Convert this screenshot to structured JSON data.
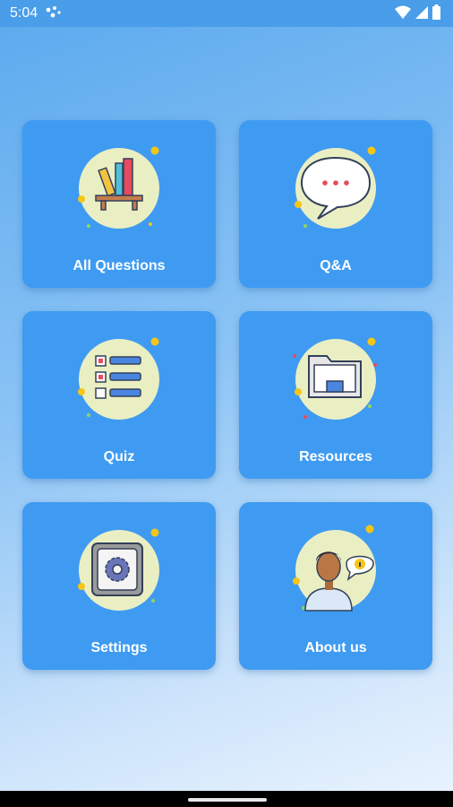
{
  "status_bar": {
    "time": "5:04",
    "icons": [
      "notification-dots-icon",
      "wifi-icon",
      "signal-icon",
      "battery-icon"
    ]
  },
  "menu": {
    "tiles": [
      {
        "label": "All Questions",
        "icon": "bookshelf-icon"
      },
      {
        "label": "Q&A",
        "icon": "speech-bubble-icon"
      },
      {
        "label": "Quiz",
        "icon": "checklist-icon"
      },
      {
        "label": "Resources",
        "icon": "folder-icon"
      },
      {
        "label": "Settings",
        "icon": "gear-icon"
      },
      {
        "label": "About us",
        "icon": "person-info-icon"
      }
    ]
  },
  "colors": {
    "tile_background": "#3f9bf1",
    "icon_circle": "#eaefc3",
    "status_bar": "#4a9de8"
  }
}
